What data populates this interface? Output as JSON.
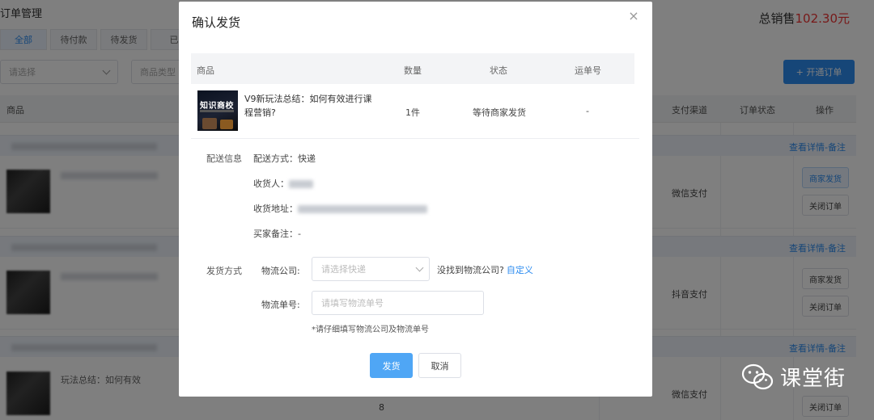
{
  "background": {
    "page_title": "订单管理",
    "total_sales_label": "总销售",
    "total_sales_value": "102.30元",
    "tabs": [
      "全部",
      "待付款",
      "待发货",
      "已"
    ],
    "filter_select_placeholder": "请选择",
    "filter_type_placeholder": "商品类型",
    "open_order_button": "+ 开通订单",
    "table_headers": {
      "product": "商品",
      "pay_channel": "支付渠道",
      "order_status": "订单状态",
      "operation": "操作"
    },
    "groups": [
      {
        "detail_link": "查看详情-备注",
        "pay_channel": "微信支付",
        "buttons": [
          "商家发货",
          "关闭订单"
        ]
      },
      {
        "detail_link": "查看详情-备注",
        "pay_channel": "抖音支付",
        "buttons": [
          "商家发货",
          "关闭订单"
        ]
      },
      {
        "detail_link": "查看详情-备注",
        "pay_channel": "微信支付",
        "buttons": [
          "关闭订单"
        ],
        "partial_name": "玩法总结：如何有效",
        "partial_qty": "8"
      }
    ]
  },
  "modal": {
    "title": "确认发货",
    "close_icon": "close-icon",
    "table_headers": {
      "product": "商品",
      "quantity": "数量",
      "status": "状态",
      "tracking": "运单号"
    },
    "product": {
      "thumb_text": "知识商校",
      "name": "V9新玩法总结：如何有效进行课程营销?",
      "quantity": "1件",
      "status": "等待商家发货",
      "tracking": "-"
    },
    "delivery_info": {
      "label": "配送信息",
      "method": "配送方式：快递",
      "recipient_label": "收货人：",
      "address_label": "收货地址：",
      "buyer_note": "买家备注：-"
    },
    "shipping": {
      "label": "发货方式",
      "company_label": "物流公司:",
      "company_placeholder": "请选择快递",
      "not_found_text": "没找到物流公司?",
      "custom_link": "自定义",
      "tracking_label": "物流单号:",
      "tracking_placeholder": "请填写物流单号",
      "hint": "*请仔细填写物流公司及物流单号"
    },
    "buttons": {
      "confirm": "发货",
      "cancel": "取消"
    }
  },
  "watermark": {
    "icon": "wechat-icon",
    "text": "课堂街"
  },
  "colors": {
    "primary": "#2d8cf0",
    "primary_button": "#4fa6f5",
    "sales_amount": "#e33333"
  }
}
